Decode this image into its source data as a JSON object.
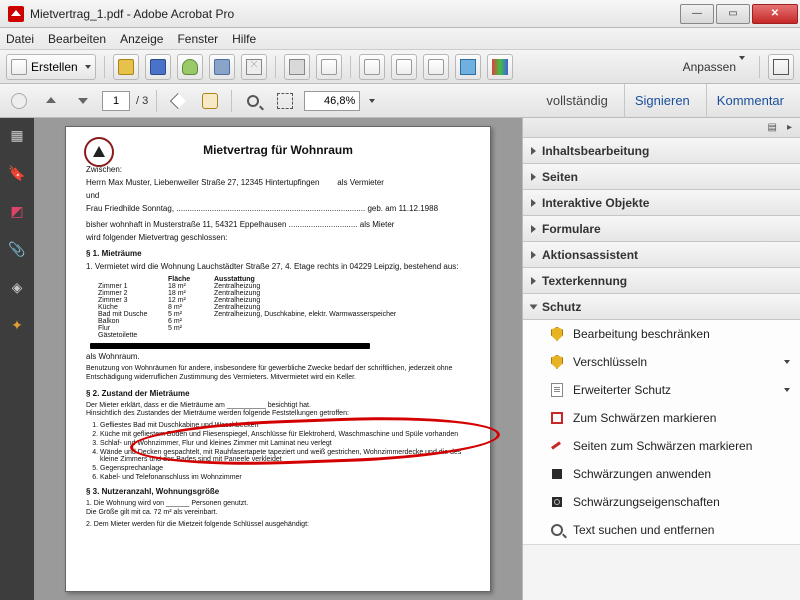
{
  "title": "Mietvertrag_1.pdf - Adobe Acrobat Pro",
  "menu": [
    "Datei",
    "Bearbeiten",
    "Anzeige",
    "Fenster",
    "Hilfe"
  ],
  "tb1": {
    "create": "Erstellen",
    "customize": "Anpassen"
  },
  "tb2": {
    "page_current": "1",
    "page_total": "/ 3",
    "zoom": "46,8%"
  },
  "topright": {
    "full": "vollständig",
    "sign": "Signieren",
    "comment": "Kommentar"
  },
  "accordions": [
    "Inhaltsbearbeitung",
    "Seiten",
    "Interaktive Objekte",
    "Formulare",
    "Aktionsassistent",
    "Texterkennung",
    "Schutz"
  ],
  "schutz_items": [
    "Bearbeitung beschränken",
    "Verschlüsseln",
    "Erweiterter Schutz",
    "Zum Schwärzen markieren",
    "Seiten zum Schwärzen markieren",
    "Schwärzungen anwenden",
    "Schwärzungseigenschaften",
    "Text suchen und entfernen"
  ],
  "doc": {
    "h1": "Mietvertrag für Wohnraum",
    "zwischen": "Zwischen:",
    "vermieter": "Herrn Max Muster, Liebenweiler Straße 27, 12345 Hintertupfingen",
    "vrole": "als Vermieter",
    "und": "und",
    "mieter": "Frau Friedhilde Sonntag, ",
    "mieter2": "geb. am 11.12.1988",
    "wohnhaft": "bisher wohnhaft in Musterstraße 11, 54321 Eppelhausen ",
    "mrole": "als Mieter",
    "closing": "wird folgender Mietvertrag geschlossen:",
    "s1": "§ 1.  Mieträume",
    "s1_1": "1.   Vermietet wird die Wohnung Lauchstädter Straße 27, 4. Etage rechts in 04229 Leipzig, bestehend aus:",
    "thead": [
      "",
      "Fläche",
      "Ausstattung"
    ],
    "rows": [
      [
        "Zimmer 1",
        "18 m²",
        "Zentralheizung"
      ],
      [
        "Zimmer 2",
        "18 m²",
        "Zentralheizung"
      ],
      [
        "Zimmer 3",
        "12 m²",
        "Zentralheizung"
      ],
      [
        "Küche",
        "8 m²",
        "Zentralheizung"
      ],
      [
        "Bad mit Dusche",
        "5 m²",
        "Zentralheizung, Duschkabine, elektr. Warmwasserspeicher"
      ],
      [
        "Balkon",
        "6 m²",
        ""
      ],
      [
        "Flur",
        "5 m²",
        ""
      ],
      [
        "Gästetoilette",
        "",
        ""
      ]
    ],
    "alsWohn": "als Wohnraum.",
    "s1_after": "Benutzung von Wohnräumen für andere, insbesondere für gewerbliche Zwecke bedarf der schriftlichen, jederzeit ohne Entschädigung widerruflichen Zustimmung des Vermieters. Mitvermietet wird ein Keller.",
    "s2": "§ 2.  Zustand der Mieträume",
    "s2_intro": "Der Mieter erklärt, dass er die Mieträume am __________ besichtigt hat.\nHinsichtlich des Zustandes der Mieträume werden folgende Feststellungen getroffen:",
    "s2_items": [
      "Gefliestes Bad mit Duschkabine und Waschbecken",
      "Küche mit gefliestem Boden und Fliesenspiegel, Anschlüsse für Elektroherd, Waschmaschine und Spüle vorhanden",
      "Schlaf- und Wohnzimmer, Flur und kleines Zimmer mit Laminat neu verlegt",
      "Wände und Decken gespachtelt, mit Rauhfasertapete tapeziert und weiß gestrichen, Wohnzimmerdecke und die des kleine Zimmers und des Bades sind mit Paneele verkleidet",
      "Gegensprechanlage",
      "Kabel- und Telefonanschluss im Wohnzimmer"
    ],
    "s3": "§ 3.  Nutzeranzahl, Wohnungsgröße",
    "s3_1": "1.   Die Wohnung wird von ______ Personen genutzt.\n      Die Größe gilt mit ca. 72 m² als vereinbart.",
    "s3_2": "2.   Dem Mieter werden für die Mietzeit folgende Schlüssel ausgehändigt:"
  }
}
